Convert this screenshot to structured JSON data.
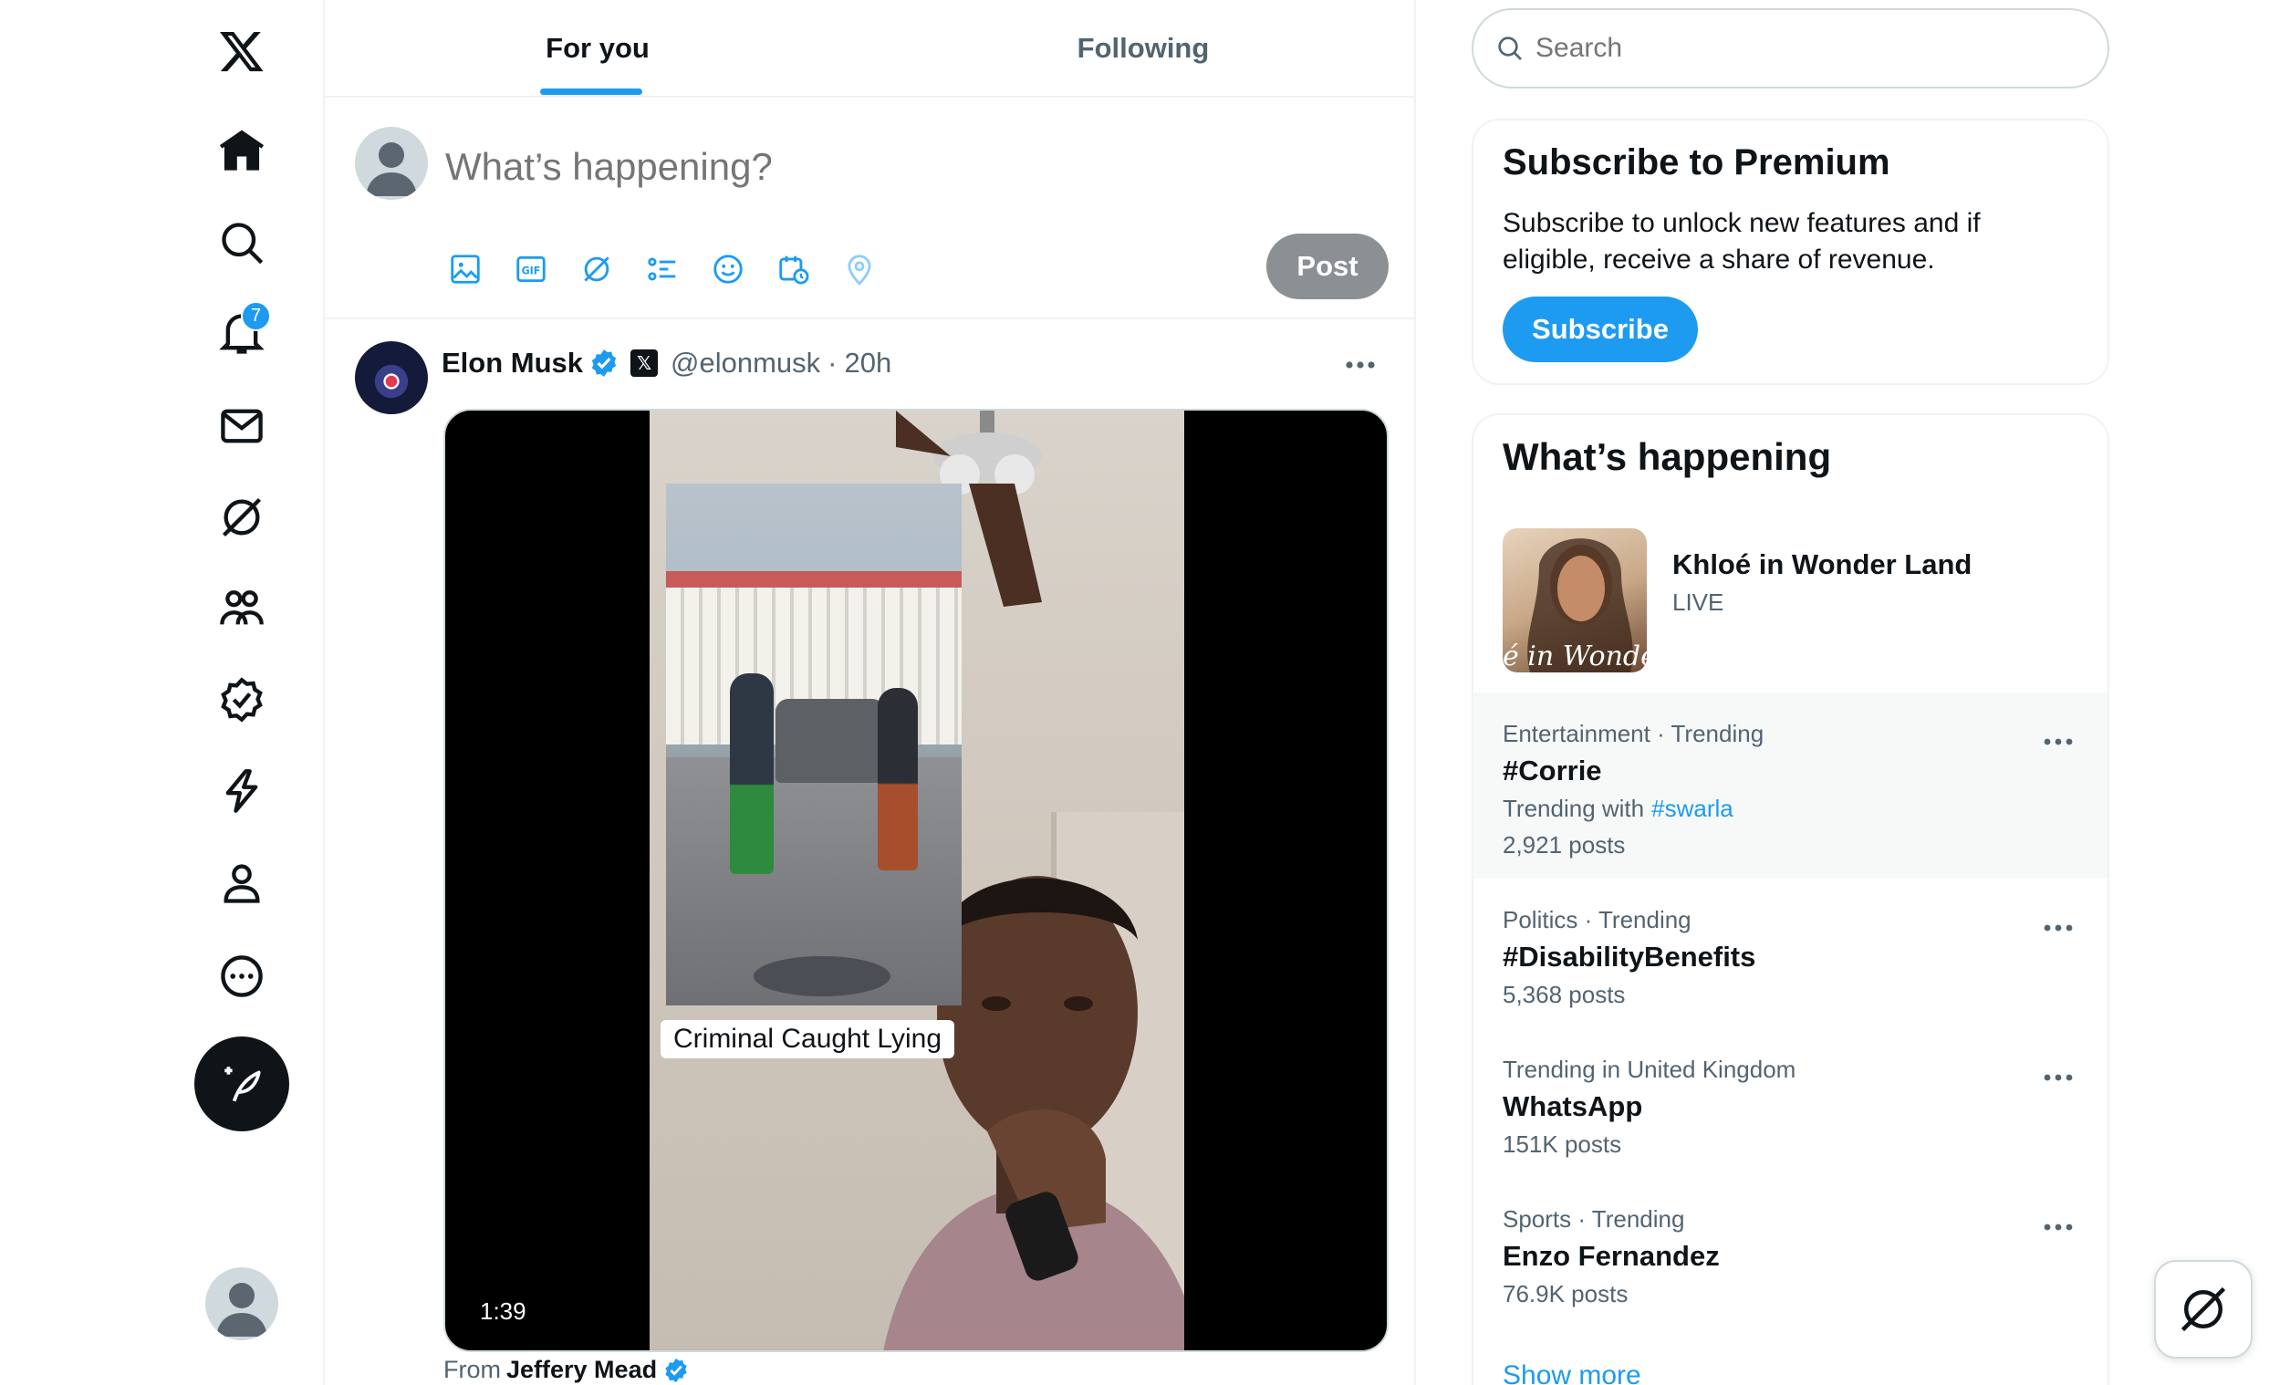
{
  "nav": {
    "logo": "x-logo-icon",
    "items": [
      {
        "icon": "home-icon"
      },
      {
        "icon": "search-icon"
      },
      {
        "icon": "bell-icon",
        "badge": "7"
      },
      {
        "icon": "mail-icon"
      },
      {
        "icon": "grok-icon"
      },
      {
        "icon": "communities-icon"
      },
      {
        "icon": "verified-icon"
      },
      {
        "icon": "lightning-icon"
      },
      {
        "icon": "profile-icon"
      },
      {
        "icon": "more-circle-icon"
      }
    ],
    "compose": "compose-post-icon"
  },
  "tabs": [
    {
      "label": "For you",
      "active": true
    },
    {
      "label": "Following",
      "active": false
    }
  ],
  "composer": {
    "placeholder": "What’s happening?",
    "post_label": "Post",
    "tools": [
      "image-icon",
      "gif-icon",
      "grok-icon",
      "poll-icon",
      "emoji-icon",
      "schedule-icon",
      "location-icon"
    ]
  },
  "tweet": {
    "name": "Elon Musk",
    "handle": "@elonmusk",
    "separator": "·",
    "time": "20h",
    "media": {
      "caption": "Criminal Caught Lying",
      "duration": "1:39"
    },
    "from_prefix": "From",
    "from_name": "Jeffery Mead"
  },
  "search": {
    "placeholder": "Search"
  },
  "premium": {
    "title": "Subscribe to Premium",
    "text": "Subscribe to unlock new features and if eligible, receive a share of revenue.",
    "button": "Subscribe"
  },
  "trends": {
    "title": "What’s happening",
    "live": {
      "title": "Khloé in Wonder Land",
      "status": "LIVE",
      "thumb_text": "é in Wonder l"
    },
    "items": [
      {
        "meta": "Entertainment · Trending",
        "title": "#Corrie",
        "trending_with_label": "Trending with",
        "trending_with_tag": "#swarla",
        "posts": "2,921 posts"
      },
      {
        "meta": "Politics · Trending",
        "title": "#DisabilityBenefits",
        "posts": "5,368 posts"
      },
      {
        "meta": "Trending in United Kingdom",
        "title": "WhatsApp",
        "posts": "151K posts"
      },
      {
        "meta": "Sports · Trending",
        "title": "Enzo Fernandez",
        "posts": "76.9K posts"
      }
    ],
    "show_more": "Show more"
  },
  "colors": {
    "accent": "#1d9bf0",
    "text": "#0f1419",
    "muted": "#536471",
    "border": "#eff3f4",
    "hover_bg": "#f7f9f9"
  }
}
